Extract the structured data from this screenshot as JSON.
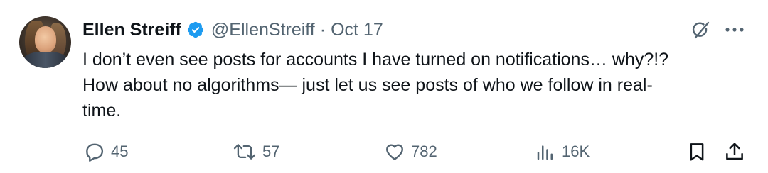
{
  "author": {
    "name": "Ellen Streiff",
    "handle": "@EllenStreiff",
    "separator": "·",
    "date": "Oct 17",
    "verified": true
  },
  "tweet": {
    "text": "I don’t even see posts for accounts I have turned on notifications… why?!?\nHow about no algorithms— just let us see posts of who we follow in real-\ntime."
  },
  "actions": {
    "replies": "45",
    "reposts": "57",
    "likes": "782",
    "views": "16K"
  },
  "icons": {
    "verified": "verified-badge-icon",
    "grok": "grok-icon",
    "more": "more-icon",
    "reply": "reply-icon",
    "repost": "repost-icon",
    "like": "heart-icon",
    "views": "views-icon",
    "bookmark": "bookmark-icon",
    "share": "share-icon"
  },
  "colors": {
    "text": "#0f1419",
    "secondary": "#536471",
    "verified": "#1d9bf0",
    "background": "#ffffff"
  }
}
